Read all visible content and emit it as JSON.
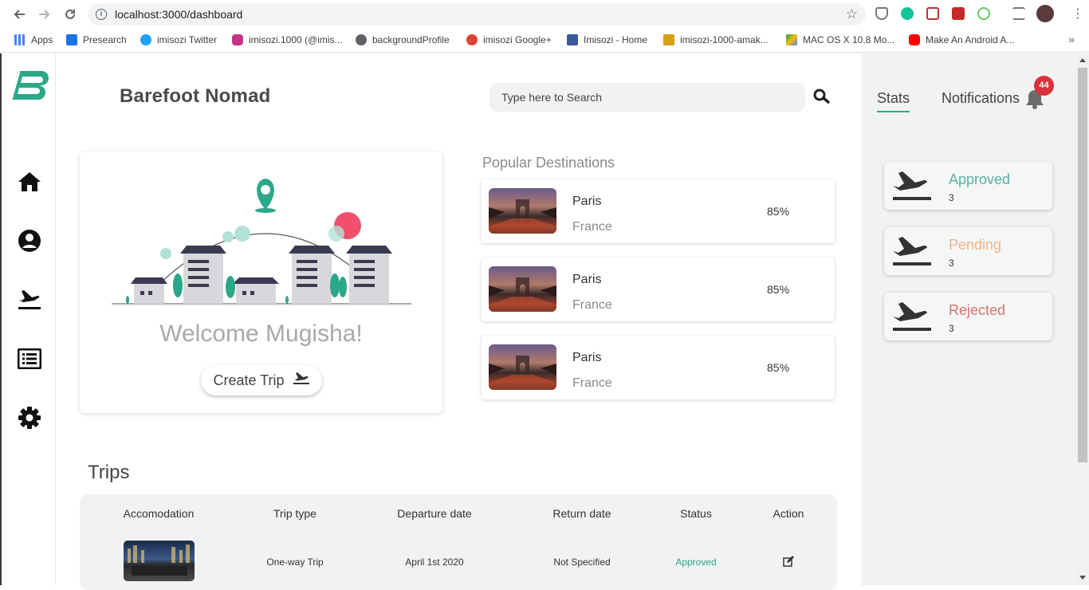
{
  "browser": {
    "url": "localhost:3000/dashboard",
    "bookmarks": [
      {
        "label": "Apps",
        "icon": "apps-grid-icon",
        "color": "#4285f4"
      },
      {
        "label": "Presearch",
        "icon": "presearch-icon",
        "color": "#1a73e8"
      },
      {
        "label": "imisozi Twitter",
        "icon": "twitter-icon",
        "color": "#1da1f2"
      },
      {
        "label": "imisozi.1000 (@imis...",
        "icon": "instagram-icon",
        "color": "#c13584"
      },
      {
        "label": "backgroundProfile",
        "icon": "globe-icon",
        "color": "#5f6368"
      },
      {
        "label": "imisozi Google+",
        "icon": "google-plus-icon",
        "color": "#db4437"
      },
      {
        "label": "Imisozi - Home",
        "icon": "facebook-icon",
        "color": "#3b5998"
      },
      {
        "label": "imisozi-1000-amak...",
        "icon": "page-icon",
        "color": "#d4a017"
      },
      {
        "label": "MAC OS X 10.8 Mo...",
        "icon": "google-drive-icon",
        "color": "#fbbc04"
      },
      {
        "label": "Make An Android A...",
        "icon": "youtube-icon",
        "color": "#ff0000"
      }
    ],
    "more": "»"
  },
  "header": {
    "brand": "Barefoot Nomad",
    "search_placeholder": "Type here to Search"
  },
  "welcome": {
    "message": "Welcome Mugisha!",
    "create_trip_label": "Create Trip"
  },
  "popular": {
    "title": "Popular Destinations",
    "items": [
      {
        "city": "Paris",
        "country": "France",
        "percent": "85%"
      },
      {
        "city": "Paris",
        "country": "France",
        "percent": "85%"
      },
      {
        "city": "Paris",
        "country": "France",
        "percent": "85%"
      }
    ]
  },
  "trips": {
    "title": "Trips",
    "columns": [
      "Accomodation",
      "Trip type",
      "Departure date",
      "Return date",
      "Status",
      "Action"
    ],
    "rows": [
      {
        "trip_type": "One-way Trip",
        "departure": "April 1st 2020",
        "return": "Not Specified",
        "status": "Approved"
      }
    ]
  },
  "panel": {
    "tabs": {
      "stats": "Stats",
      "notifications": "Notifications"
    },
    "notification_count": "44",
    "stats": [
      {
        "label": "Approved",
        "count": "3",
        "color": "#5aafa6"
      },
      {
        "label": "Pending",
        "count": "3",
        "color": "#f2b383"
      },
      {
        "label": "Rejected",
        "count": "3",
        "color": "#d9746f"
      }
    ]
  },
  "colors": {
    "brand_green": "#2aa889",
    "approved_text": "#2aa889",
    "badge_red": "#d9323a"
  }
}
